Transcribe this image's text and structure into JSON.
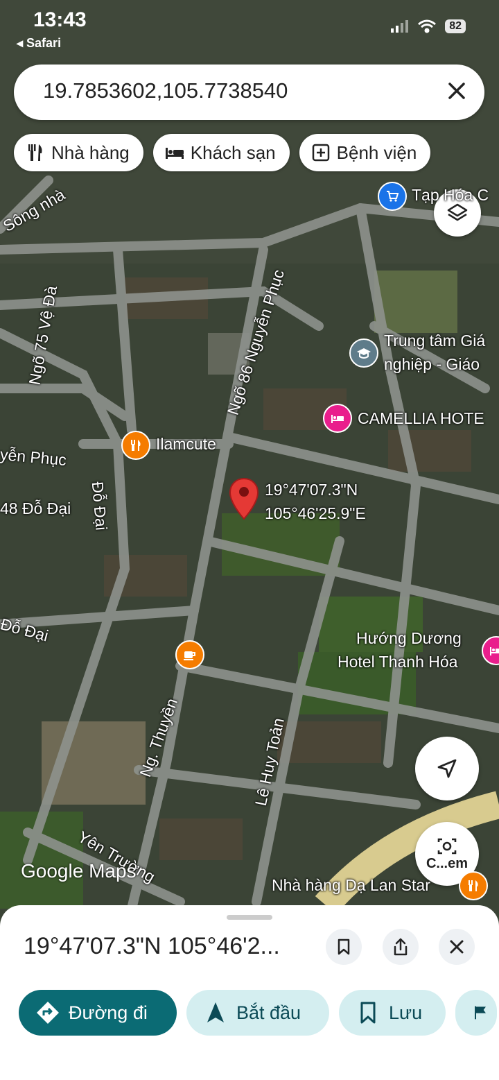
{
  "status_bar": {
    "time": "13:43",
    "back_label": "◂ Safari",
    "battery": "82"
  },
  "search": {
    "query": "19.7853602,105.7738540"
  },
  "chips": [
    {
      "label": "Nhà hàng",
      "icon": "fork-knife-icon"
    },
    {
      "label": "Khách sạn",
      "icon": "bed-icon"
    },
    {
      "label": "Bệnh viện",
      "icon": "hospital-plus-icon"
    }
  ],
  "map_labels": {
    "pin_lat": "19°47'07.3\"N",
    "pin_lng": "105°46'25.9\"E",
    "tap_hoa": "Tạp Hóa C",
    "trung_tam_1": "Trung tâm Giá",
    "trung_tam_2": "nghiệp - Giáo",
    "camellia": "CAMELLIA HOTE",
    "ilamcute": "Ilamcute",
    "huong_duong_1": "Hướng Dương",
    "huong_duong_2": "Hotel Thanh Hóa",
    "nha_hang_da_lan": "Nhà hàng Dạ Lan Star",
    "ngo_86": "Ngõ 86 Nguyễn Phục",
    "ngo_75": "Ngõ 75 Vệ Đà",
    "nguyen_phuc": "yễn Phục",
    "do_dai_48": "48 Đỗ Đại",
    "do_dai": "Đỗ Đại",
    "do_dai_2": "Đỗ Đại",
    "ng_thuyen": "Ng. Thuyền",
    "le_huy_toan": "Lê Huy Toản",
    "yen_truong": "Yên Trường",
    "song_nha": "Sông nhà",
    "camera_label": "C...em"
  },
  "brand": "Google Maps",
  "sheet": {
    "title": "19°47'07.3\"N 105°46'2...",
    "actions": [
      {
        "label": "Đường đi",
        "icon": "directions-icon"
      },
      {
        "label": "Bắt đầu",
        "icon": "navigation-arrow-icon"
      },
      {
        "label": "Lưu",
        "icon": "bookmark-icon"
      }
    ]
  },
  "colors": {
    "accent": "#0b6b74",
    "pin": "#e53935",
    "chip_light": "#d4eef0",
    "road": "#8a8f8c"
  }
}
